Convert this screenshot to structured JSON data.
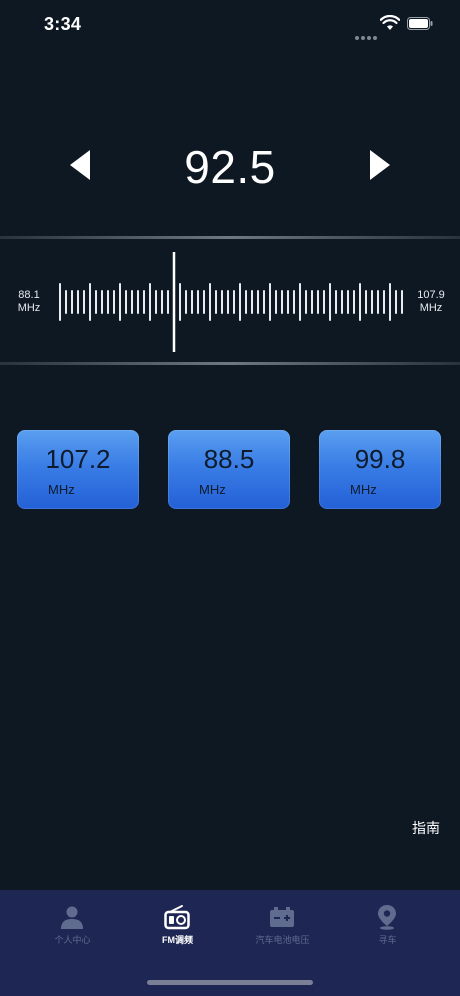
{
  "status_bar": {
    "time": "3:34"
  },
  "tuner": {
    "frequency": "92.5",
    "current_mhz": 92.5,
    "scale_min_value": "88.1",
    "scale_max_value": "107.9",
    "unit": "MHz"
  },
  "presets": [
    {
      "value": "107.2",
      "unit": "MHz"
    },
    {
      "value": "88.5",
      "unit": "MHz"
    },
    {
      "value": "99.8",
      "unit": "MHz"
    }
  ],
  "guide_label": "指南",
  "tabs": [
    {
      "label": "个人中心",
      "icon": "person-icon",
      "active": false
    },
    {
      "label": "FM调频",
      "icon": "radio-icon",
      "active": true
    },
    {
      "label": "汽车电池电压",
      "icon": "battery-icon",
      "active": false
    },
    {
      "label": "寻车",
      "icon": "location-pin-icon",
      "active": false
    }
  ],
  "colors": {
    "background": "#0e1822",
    "preset_blue": "#3a7de6",
    "tab_bar": "#1e2754",
    "tab_inactive": "#5f6b8f"
  }
}
